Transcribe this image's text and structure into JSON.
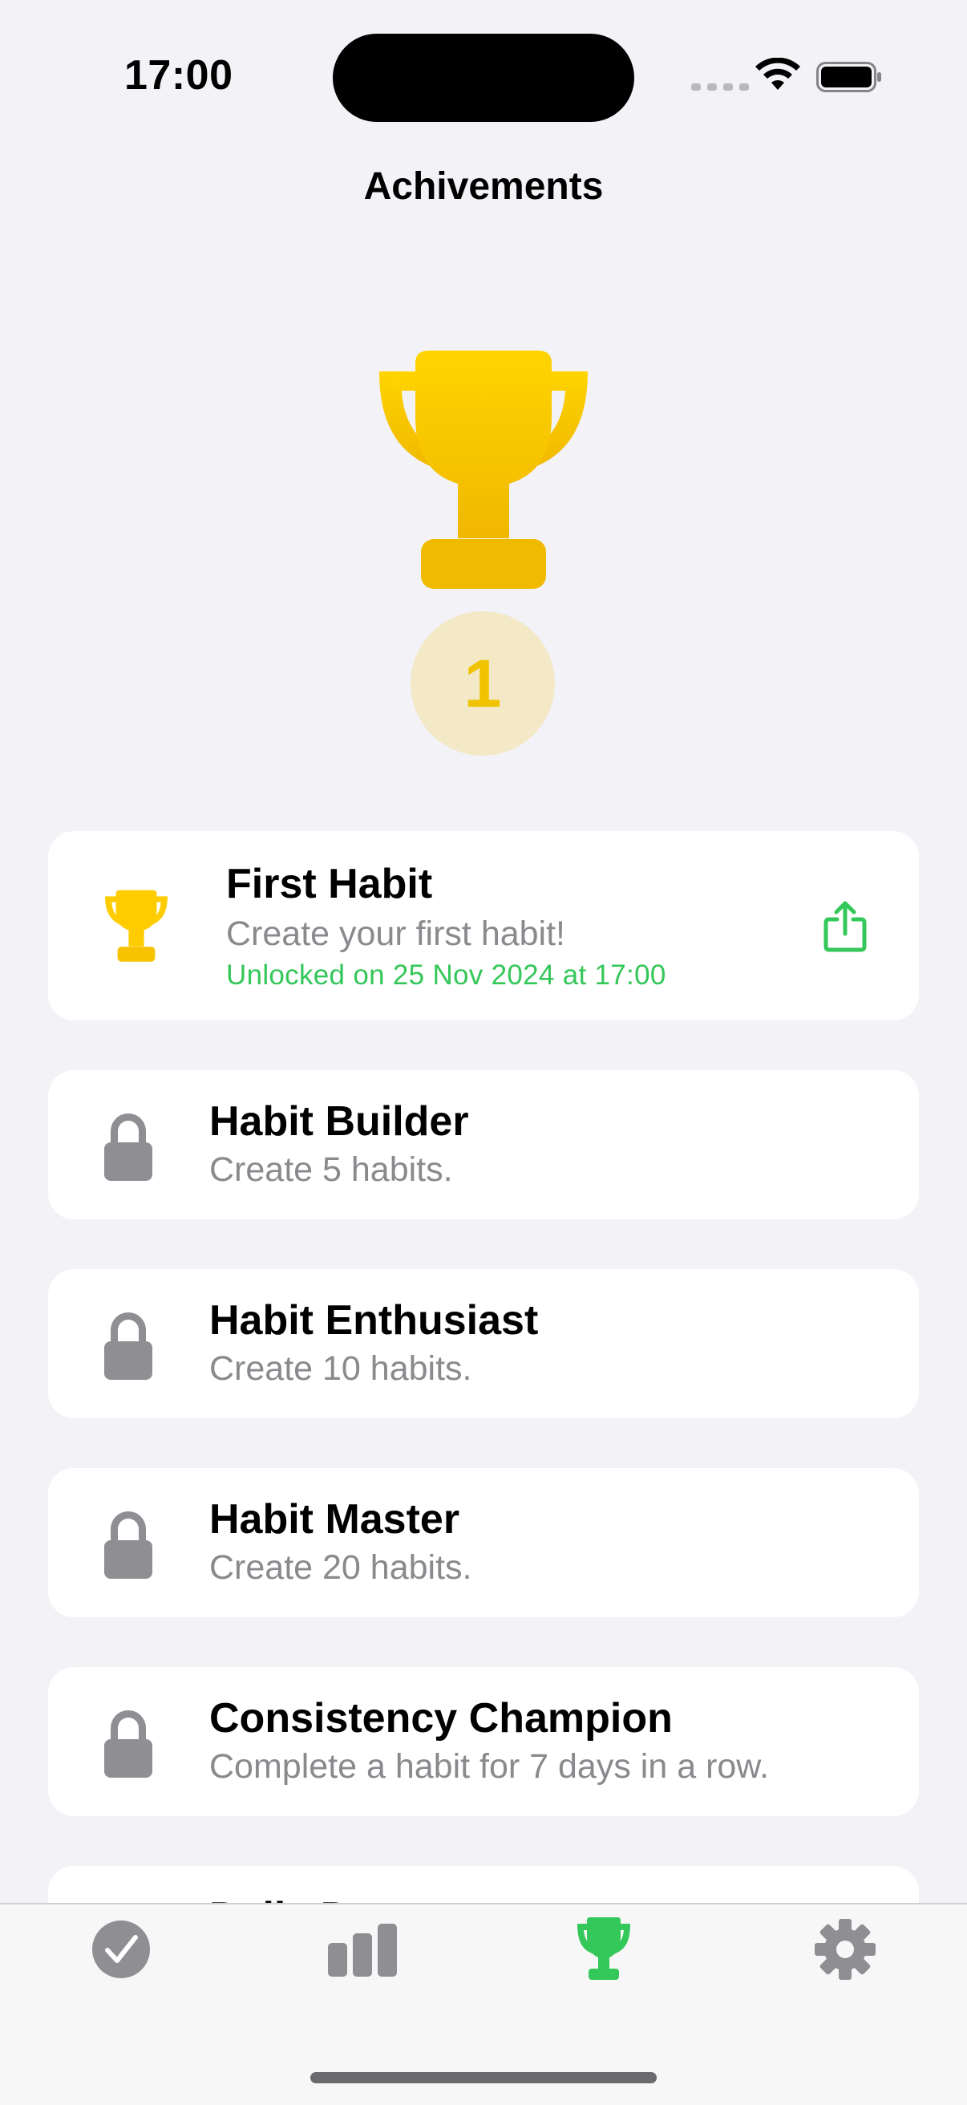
{
  "status_bar": {
    "time": "17:00"
  },
  "header": {
    "title": "Achivements"
  },
  "summary": {
    "unlocked_count": "1"
  },
  "achievements": [
    {
      "title": "First Habit",
      "description": "Create your first habit!",
      "unlocked_text": "Unlocked on 25 Nov 2024 at 17:00",
      "unlocked": true
    },
    {
      "title": "Habit Builder",
      "description": "Create 5 habits.",
      "unlocked": false
    },
    {
      "title": "Habit Enthusiast",
      "description": "Create 10 habits.",
      "unlocked": false
    },
    {
      "title": "Habit Master",
      "description": "Create 20 habits.",
      "unlocked": false
    },
    {
      "title": "Consistency Champion",
      "description": "Complete a habit for 7 days in a row.",
      "unlocked": false
    },
    {
      "title": "Daily D",
      "description": "",
      "unlocked": false
    }
  ],
  "tabs": [
    {
      "icon": "checkmark-circle-icon",
      "selected": false
    },
    {
      "icon": "bar-chart-icon",
      "selected": false
    },
    {
      "icon": "trophy-icon",
      "selected": true
    },
    {
      "icon": "gear-icon",
      "selected": false
    }
  ],
  "colors": {
    "background": "#F2F2F7",
    "gold": "#FFCC00",
    "green": "#34C759",
    "gray": "#8E8E93"
  }
}
